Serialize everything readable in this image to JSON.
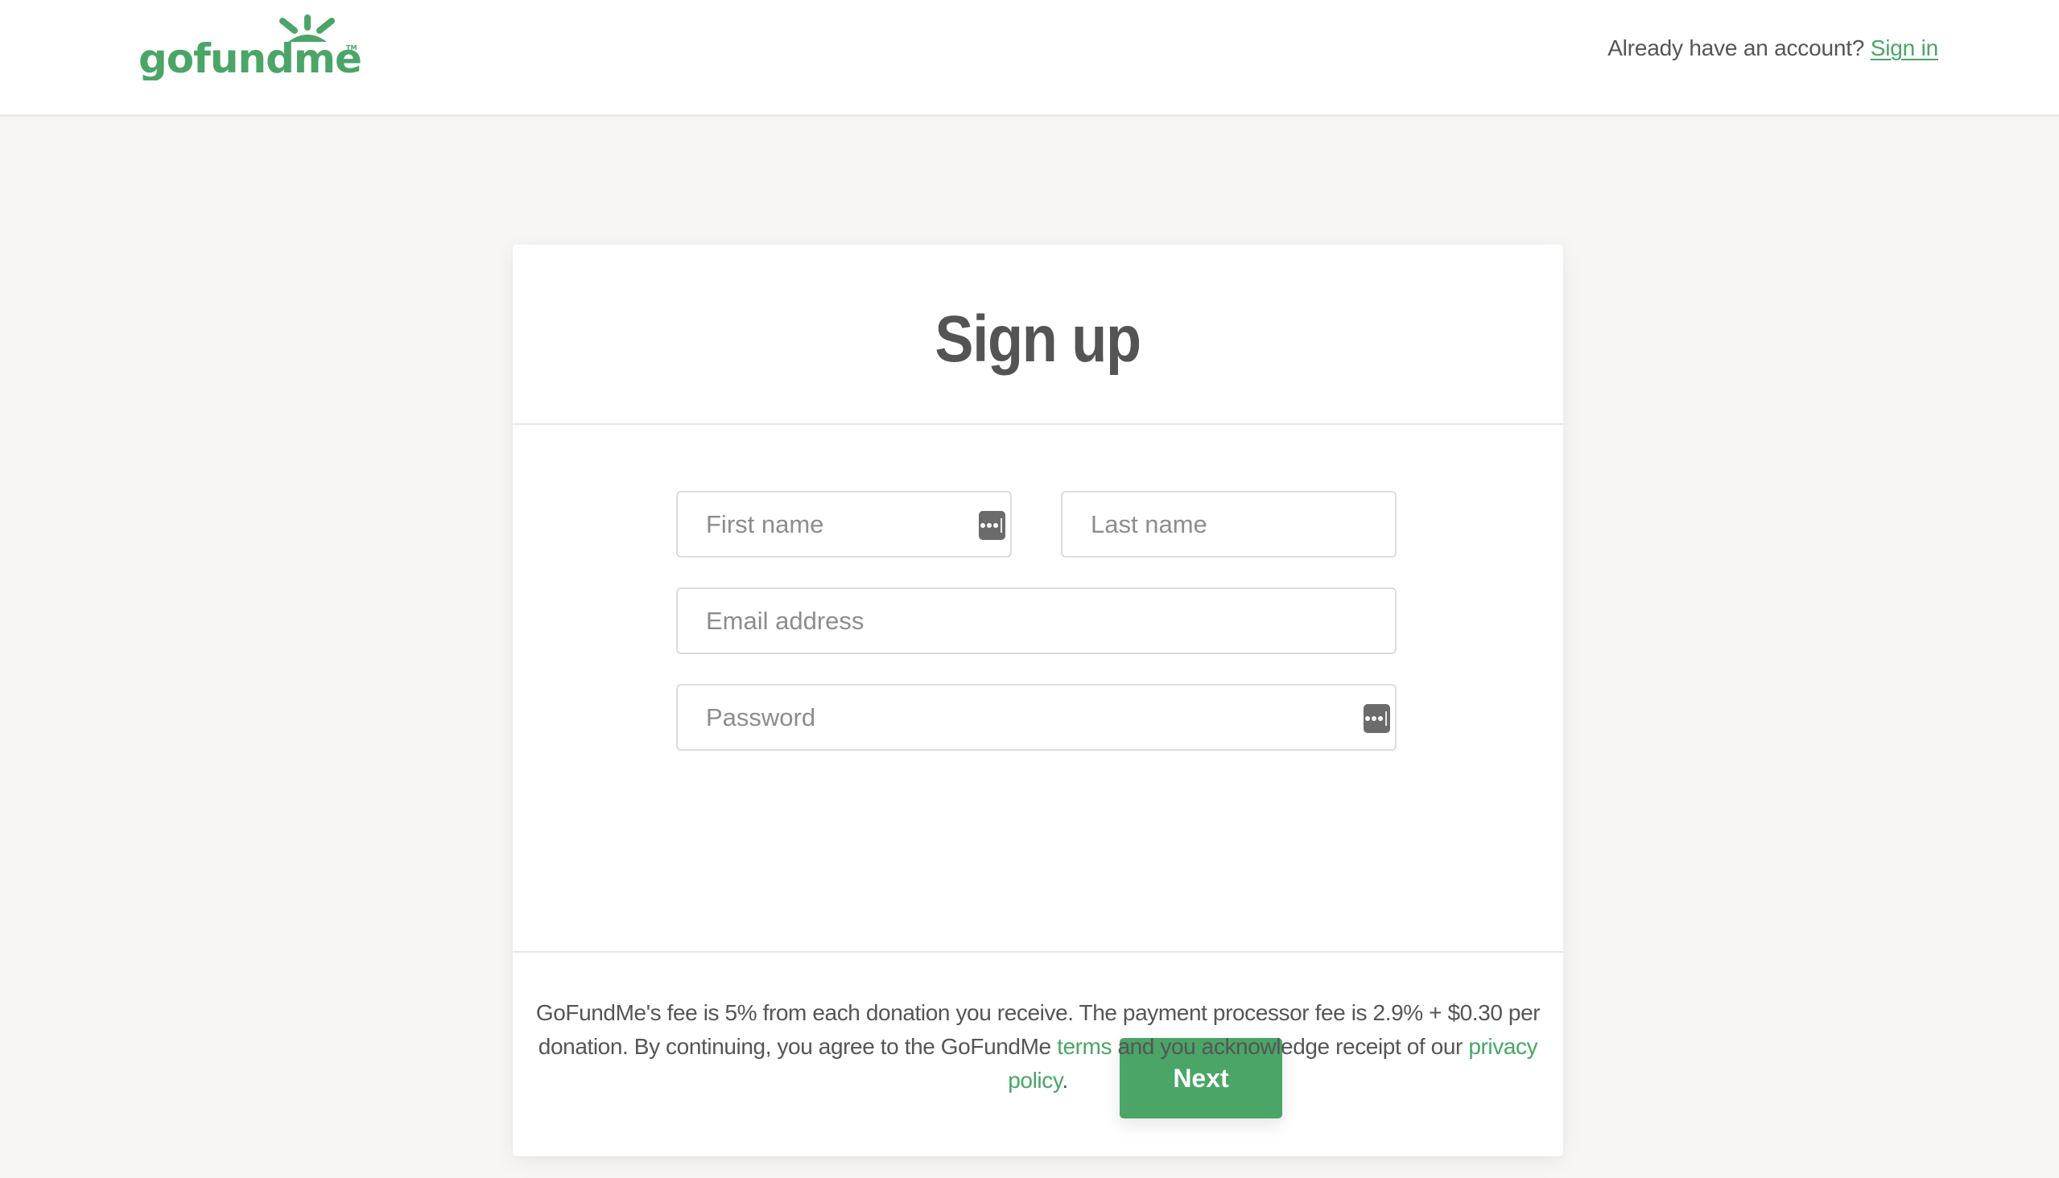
{
  "brand": {
    "name": "gofundme",
    "trademark": "TM",
    "accent_color": "#4aa567"
  },
  "header": {
    "prompt_text": "Already have an account?",
    "sign_in_label": "Sign in"
  },
  "card": {
    "title": "Sign up",
    "fields": {
      "first_name": {
        "placeholder": "First name",
        "value": "",
        "has_password_manager_icon": true
      },
      "last_name": {
        "placeholder": "Last name",
        "value": ""
      },
      "email": {
        "placeholder": "Email address",
        "value": ""
      },
      "password": {
        "placeholder": "Password",
        "value": "",
        "has_password_manager_icon": true
      }
    },
    "next_label": "Next",
    "footer": {
      "text_before_terms": "GoFundMe's fee is 5% from each donation you receive. The payment processor fee is 2.9% + $0.30 per donation. By continuing, you agree to the GoFundMe ",
      "terms_label": "terms",
      "text_between": " and you acknowledge receipt of our ",
      "privacy_label": "privacy policy",
      "text_after": "."
    }
  },
  "icons": {
    "password_manager": "password-manager-key-icon"
  }
}
